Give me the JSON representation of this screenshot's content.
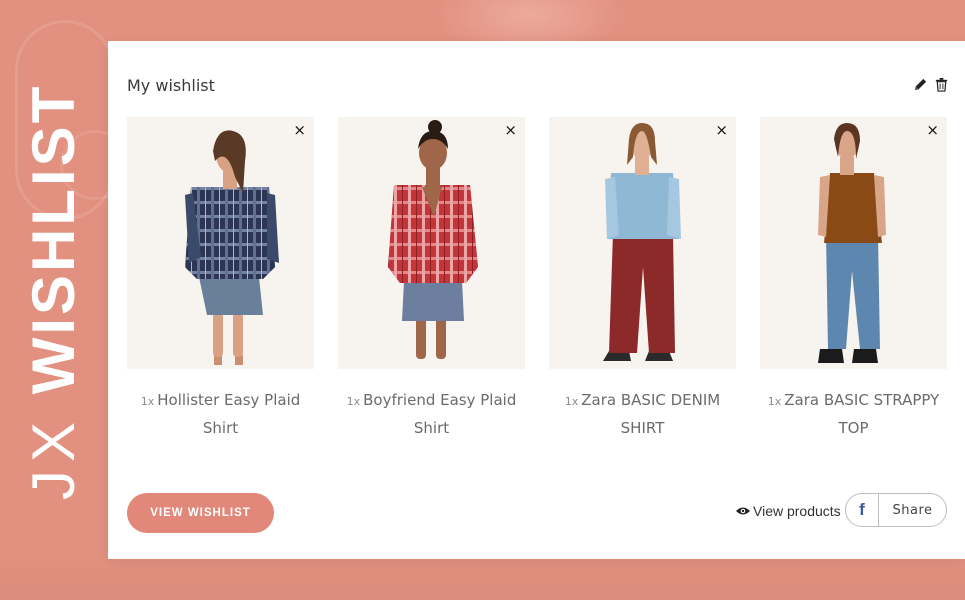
{
  "vertical_title": {
    "part1": "JX",
    "part2": "WISHLIST"
  },
  "wishlist": {
    "title": "My wishlist"
  },
  "header_icons": [
    "pencil-icon",
    "trash-icon"
  ],
  "products": [
    {
      "qty": "1x",
      "name": "Hollister Easy Plaid Shirt",
      "remove": "×"
    },
    {
      "qty": "1x",
      "name": "Boyfriend Easy Plaid Shirt",
      "remove": "×"
    },
    {
      "qty": "1x",
      "name": "Zara BASIC DENIM SHIRT",
      "remove": "×"
    },
    {
      "qty": "1x",
      "name": "Zara BASIC STRAPPY TOP",
      "remove": "×"
    }
  ],
  "actions": {
    "view_wishlist": "VIEW WISHLIST",
    "view_products": "View products",
    "share_icon": "f",
    "share": "Share"
  },
  "colors": {
    "background": "#e2907f",
    "button": "#e2887a",
    "facebook": "#3b5998"
  }
}
